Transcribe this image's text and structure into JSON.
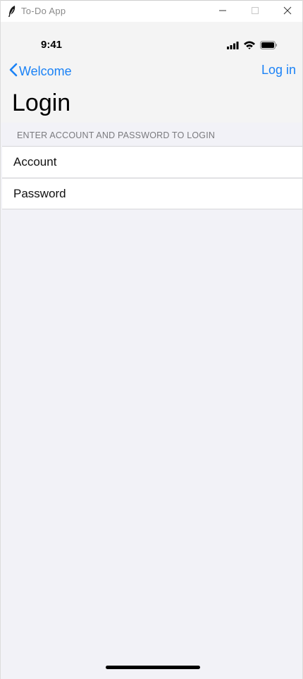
{
  "window": {
    "title": "To-Do App",
    "icons": [
      "feather-icon",
      "minimize-icon",
      "maximize-icon",
      "close-icon"
    ]
  },
  "status_bar": {
    "time": "9:41",
    "icons": [
      "cellular-signal-icon",
      "wifi-icon",
      "battery-icon"
    ]
  },
  "nav": {
    "back_label": "Welcome",
    "back_icon": "chevron-left-icon",
    "action_label": "Log in",
    "title": "Login",
    "accent_color": "#1a82f6"
  },
  "form": {
    "section_header": "ENTER ACCOUNT AND PASSWORD TO LOGIN",
    "account_placeholder": "Account",
    "password_placeholder": "Password"
  }
}
